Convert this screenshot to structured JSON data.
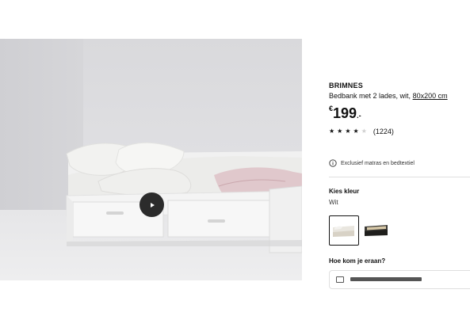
{
  "media": {
    "play_icon": "play-icon"
  },
  "product": {
    "name": "BRIMNES",
    "description": "Bedbank met 2 lades, wit,",
    "size_link": "80x200 cm",
    "price": {
      "currency": "€",
      "amount": "199",
      "suffix": ".-"
    },
    "rating": {
      "stars": 4,
      "max": 5,
      "count": "(1224)"
    },
    "notice": "Exclusief matras en bedtextiel",
    "notice_icon": "info-icon"
  },
  "color": {
    "label": "Kies kleur",
    "selected": "Wit",
    "options": [
      "white-variant",
      "black-variant"
    ]
  },
  "delivery": {
    "label": "Hoe kom je eraan?"
  }
}
